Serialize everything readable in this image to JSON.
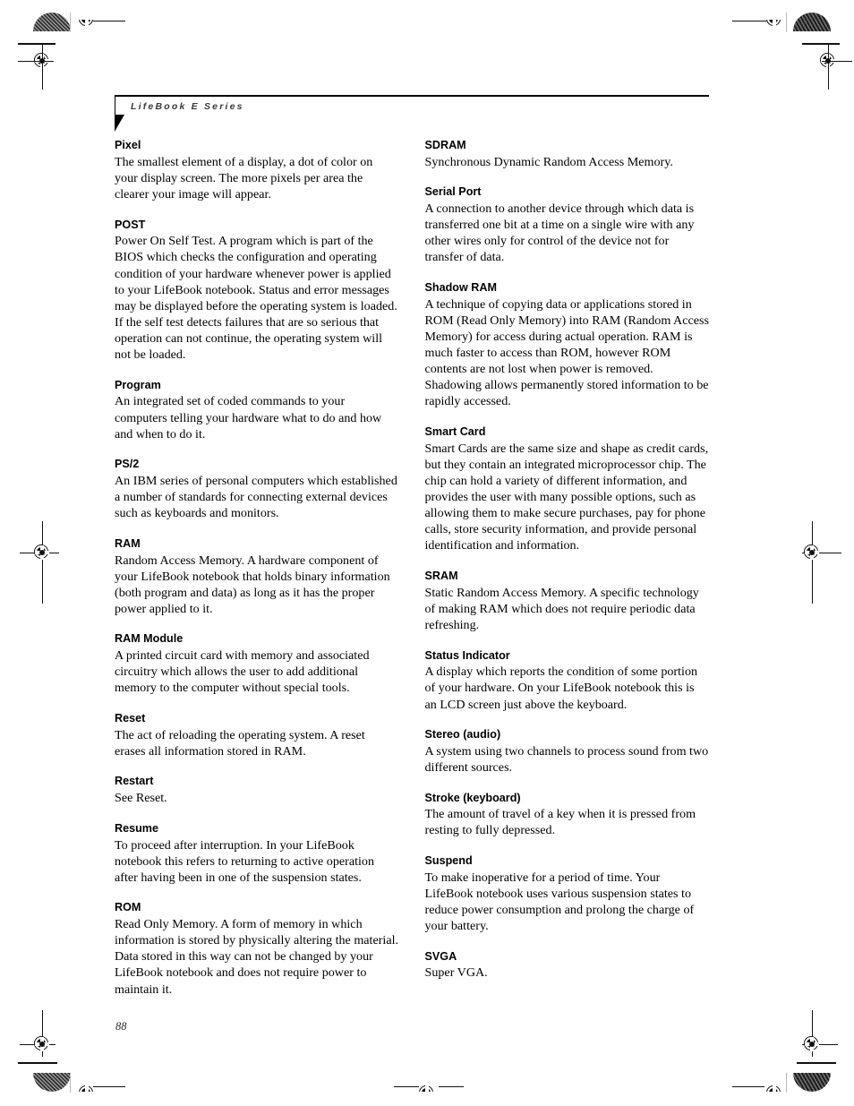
{
  "header": {
    "title": "LifeBook E Series"
  },
  "folio": {
    "page_number": "88"
  },
  "columns": {
    "left": [
      {
        "term": "Pixel",
        "definition": "The smallest element of a display, a dot of color on your display screen. The more pixels per area the clearer your image will appear."
      },
      {
        "term": "POST",
        "definition": "Power On Self Test. A program which is part of the BIOS which checks the configuration and operating condition of your hardware whenever power is applied to your LifeBook notebook. Status and error messages may be displayed before the operating system is loaded. If the self test detects failures that are so serious that operation can not continue, the operating system will not be loaded."
      },
      {
        "term": "Program",
        "definition": "An integrated set of coded commands to your computers telling your hardware what to do and how and when to do it."
      },
      {
        "term": "PS/2",
        "definition": "An IBM series of personal computers which established a number of standards for connecting external devices such as keyboards and monitors."
      },
      {
        "term": "RAM",
        "definition": "Random Access Memory. A hardware component of your LifeBook notebook that holds binary information (both program and data) as long as it has the proper power applied to it."
      },
      {
        "term": "RAM Module",
        "definition": "A printed circuit card with memory and associated circuitry which allows the user to add additional memory to the computer without special tools."
      },
      {
        "term": "Reset",
        "definition": "The act of reloading the operating system. A reset erases all information stored in RAM."
      },
      {
        "term": "Restart",
        "definition": "See Reset."
      },
      {
        "term": "Resume",
        "definition": "To proceed after interruption. In your LifeBook notebook this refers to returning to active operation after having been in one of the suspension states."
      },
      {
        "term": "ROM",
        "definition": "Read Only Memory. A form of memory in which information is stored by physically altering the material. Data stored in this way can not be changed by your LifeBook notebook and does not require power to maintain it."
      }
    ],
    "right": [
      {
        "term": "SDRAM",
        "definition": "Synchronous Dynamic Random Access Memory."
      },
      {
        "term": "Serial Port",
        "definition": "A connection to another device through which data is transferred one bit at a time on a single wire with any other wires only for control of the device not for transfer of data."
      },
      {
        "term": "Shadow RAM",
        "definition": "A technique of copying data or applications stored in ROM (Read Only Memory) into RAM (Random Access Memory) for access during actual operation. RAM is much faster to access than ROM, however ROM contents are not lost when power is removed. Shadowing allows permanently stored information to be rapidly accessed."
      },
      {
        "term": "Smart Card",
        "definition": "Smart Cards are the same size and shape as credit cards, but they contain an integrated microprocessor chip. The chip can hold a variety of different information, and provides the user with many possible options, such as allowing them to make secure purchases, pay for phone calls, store security information, and provide personal identification and information."
      },
      {
        "term": "SRAM",
        "definition": "Static Random Access Memory. A specific technology of making RAM which does not require periodic data refreshing."
      },
      {
        "term": "Status Indicator",
        "definition": "A display which reports the condition of some portion of your hardware. On your LifeBook notebook this is an LCD screen just above the keyboard."
      },
      {
        "term": "Stereo (audio)",
        "definition": "A system using two channels to process sound from two different sources."
      },
      {
        "term": "Stroke (keyboard)",
        "definition": "The amount of travel of a key when it is pressed from resting to fully depressed."
      },
      {
        "term": "Suspend",
        "definition": "To make inoperative for a period of time. Your LifeBook notebook uses various suspension states to reduce power consumption and prolong the charge of your battery."
      },
      {
        "term": "SVGA",
        "definition": "Super VGA."
      }
    ]
  }
}
